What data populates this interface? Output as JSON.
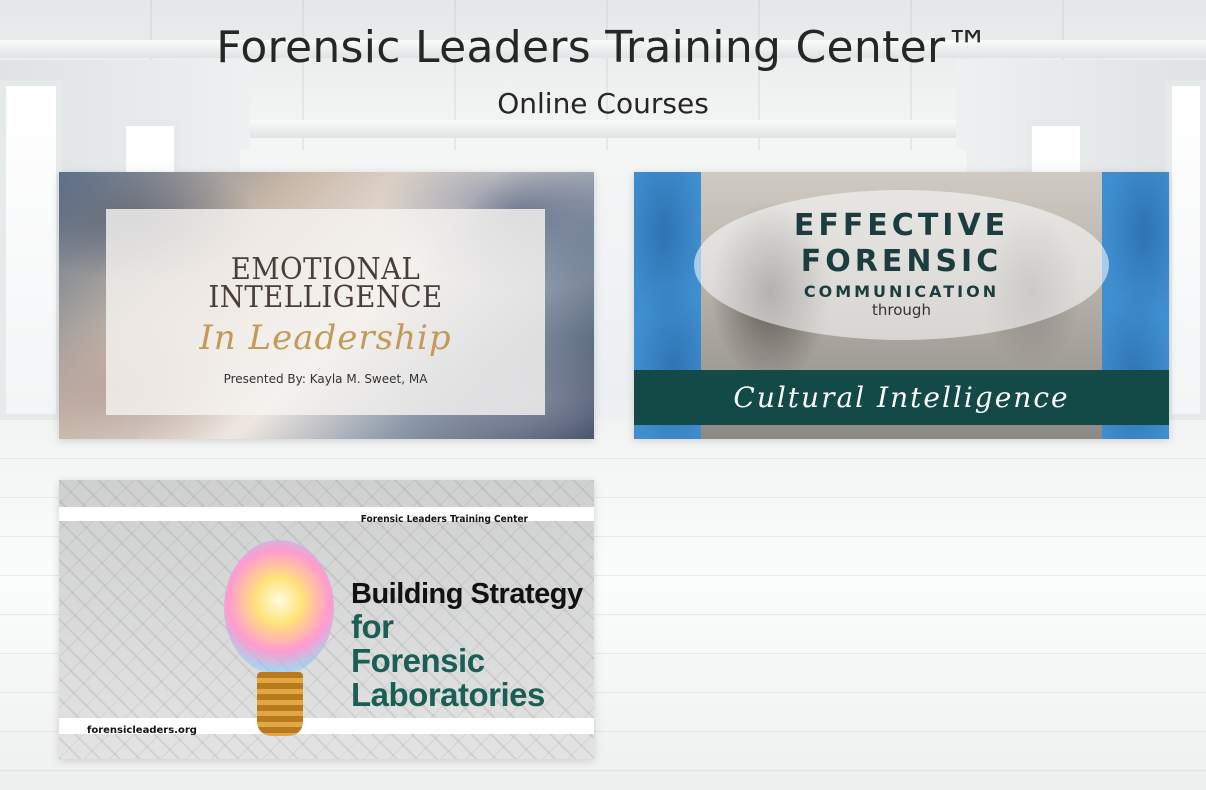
{
  "header": {
    "title": "Forensic Leaders Training Center™",
    "subtitle": "Online Courses"
  },
  "courses": [
    {
      "title_line": "EMOTIONAL INTELLIGENCE",
      "script_line": "In Leadership",
      "presenter": "Presented By: Kayla M. Sweet, MA"
    },
    {
      "line1": "EFFECTIVE",
      "line2": "FORENSIC",
      "line3": "COMMUNICATION",
      "line4": "through",
      "script_line": "Cultural Intelligence"
    },
    {
      "top_label": "Forensic Leaders Training Center",
      "line1": "Building Strategy",
      "line2": "for",
      "line3": "Forensic",
      "line4": "Laboratories",
      "site": "forensicleaders.org"
    }
  ]
}
